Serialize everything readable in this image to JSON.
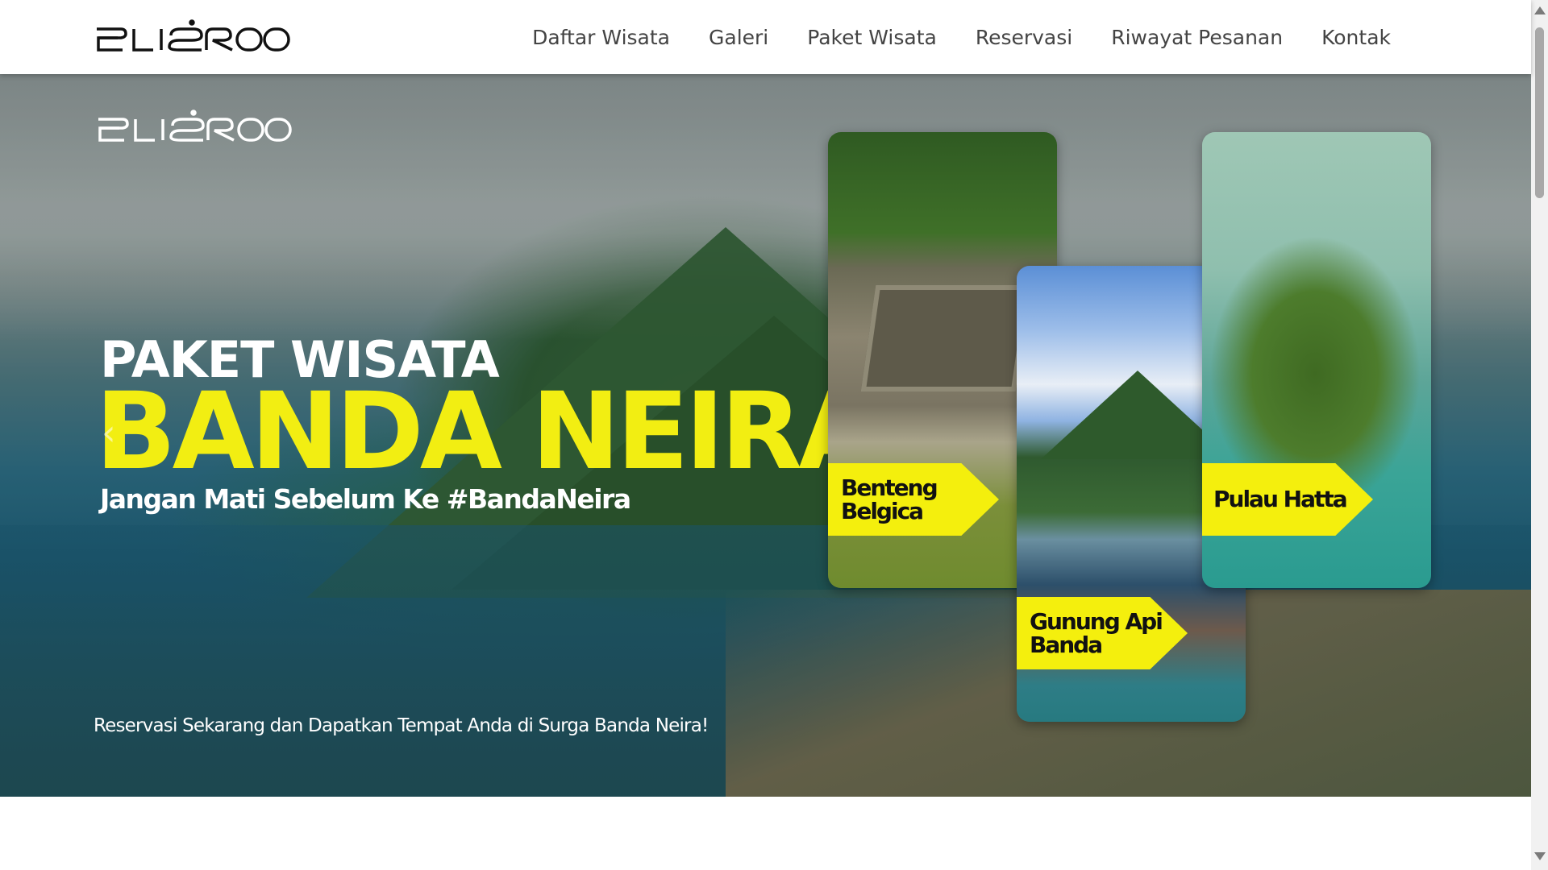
{
  "brand": {
    "logo_text": "ELISROO",
    "logo_icon": "brand-wordmark-logo"
  },
  "nav": {
    "items": [
      {
        "label": "Daftar Wisata"
      },
      {
        "label": "Galeri"
      },
      {
        "label": "Paket Wisata"
      },
      {
        "label": "Reservasi"
      },
      {
        "label": "Riwayat Pesanan"
      },
      {
        "label": "Kontak"
      }
    ]
  },
  "hero": {
    "kicker": "PAKET WISATA",
    "title": "BANDA NEIRA",
    "tagline": "Jangan Mati Sebelum Ke #BandaNeira",
    "cta": "Reservasi Sekarang dan Dapatkan Tempat Anda di Surga Banda Neira!",
    "prev_icon": "chevron-left-icon",
    "cards": [
      {
        "label_line1": "Benteng",
        "label_line2": "Belgica"
      },
      {
        "label_line1": "Gunung Api",
        "label_line2": "Banda"
      },
      {
        "label_line1": "Pulau Hatta",
        "label_line2": ""
      }
    ]
  },
  "colors": {
    "accent_yellow": "#f4ef0d",
    "nav_text": "#444444",
    "title_yellow": "#f2ee12"
  }
}
